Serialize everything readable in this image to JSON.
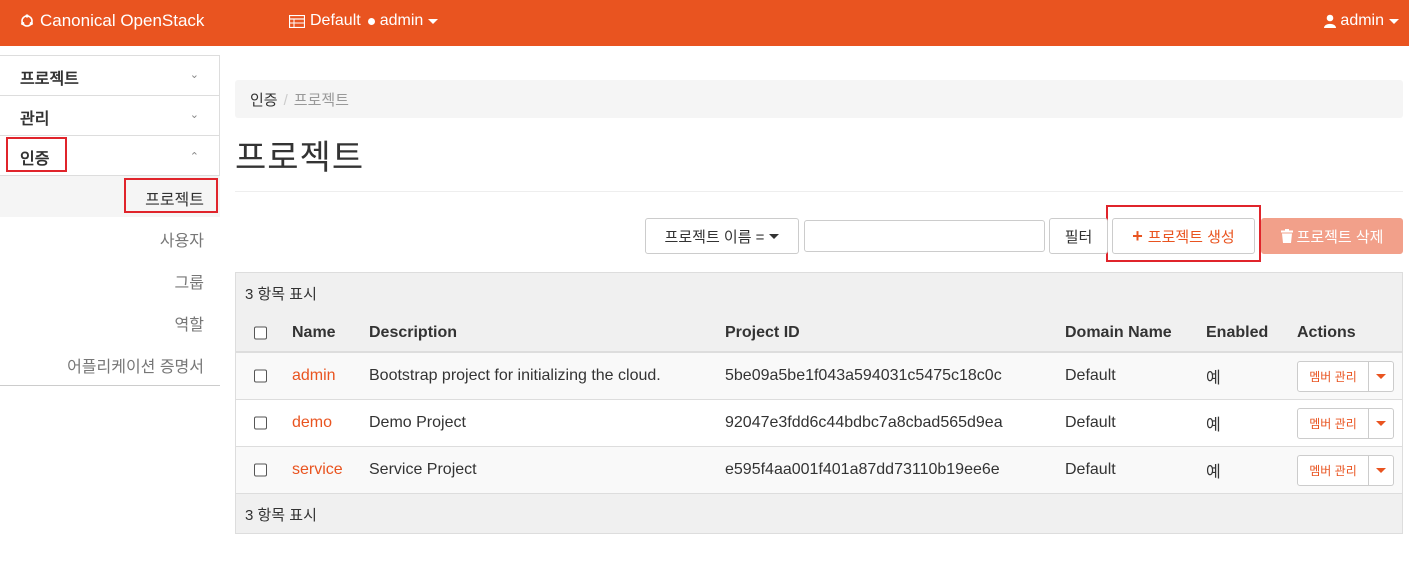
{
  "topbar": {
    "brand": "Canonical OpenStack",
    "context_domain": "Default",
    "context_project": "admin",
    "user": "admin",
    "color": "#E95420"
  },
  "sidebar": {
    "panels": [
      {
        "label": "프로젝트",
        "expanded": false
      },
      {
        "label": "관리",
        "expanded": false
      },
      {
        "label": "인증",
        "expanded": true
      }
    ],
    "identity_items": [
      {
        "label": "프로젝트",
        "active": true
      },
      {
        "label": "사용자",
        "active": false
      },
      {
        "label": "그룹",
        "active": false
      },
      {
        "label": "역할",
        "active": false
      },
      {
        "label": "어플리케이션 증명서",
        "active": false
      }
    ]
  },
  "breadcrumb": {
    "parent": "인증",
    "current": "프로젝트"
  },
  "page_title": "프로젝트",
  "toolbar": {
    "filter_field": "프로젝트 이름 =",
    "filter_value": "",
    "filter_button": "필터",
    "create_button": "프로젝트 생성",
    "delete_button": "프로젝트 삭제"
  },
  "table": {
    "count_label": "3 항목 표시",
    "columns": [
      "Name",
      "Description",
      "Project ID",
      "Domain Name",
      "Enabled",
      "Actions"
    ],
    "rows": [
      {
        "name": "admin",
        "description": "Bootstrap project for initializing the cloud.",
        "project_id": "5be09a5be1f043a594031c5475c18c0c",
        "domain": "Default",
        "enabled": "예",
        "action": "멤버 관리"
      },
      {
        "name": "demo",
        "description": "Demo Project",
        "project_id": "92047e3fdd6c44bdbc7a8cbad565d9ea",
        "domain": "Default",
        "enabled": "예",
        "action": "멤버 관리"
      },
      {
        "name": "service",
        "description": "Service Project",
        "project_id": "e595f4aa001f401a87dd73110b19ee6e",
        "domain": "Default",
        "enabled": "예",
        "action": "멤버 관리"
      }
    ],
    "footer_label": "3 항목 표시"
  }
}
